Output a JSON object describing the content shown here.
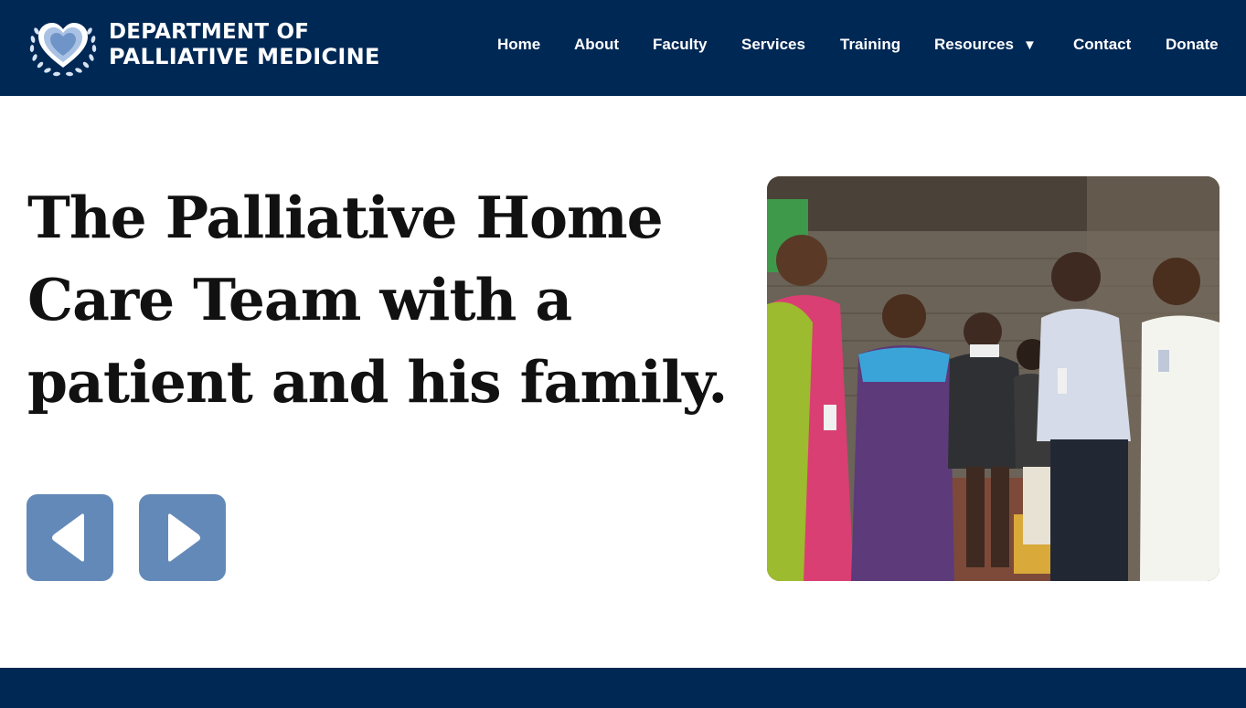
{
  "header": {
    "brand_line1": "DEPARTMENT OF",
    "brand_line2": "PALLIATIVE MEDICINE",
    "logo_icon": "heart-laurel-icon"
  },
  "nav": {
    "items": [
      {
        "label": "Home"
      },
      {
        "label": "About"
      },
      {
        "label": "Faculty"
      },
      {
        "label": "Services"
      },
      {
        "label": "Training"
      },
      {
        "label": "Resources",
        "has_dropdown": true,
        "caret": "▼"
      },
      {
        "label": "Contact"
      },
      {
        "label": "Donate"
      }
    ]
  },
  "slide": {
    "caption": "The Palliative Home Care Team with a patient and his family.",
    "prev_icon": "triangle-left-icon",
    "next_icon": "triangle-right-icon",
    "image_subject": "Palliative home care team photo"
  },
  "colors": {
    "navy": "#002855",
    "button_blue": "#6389b8",
    "text_dark": "#111111"
  }
}
